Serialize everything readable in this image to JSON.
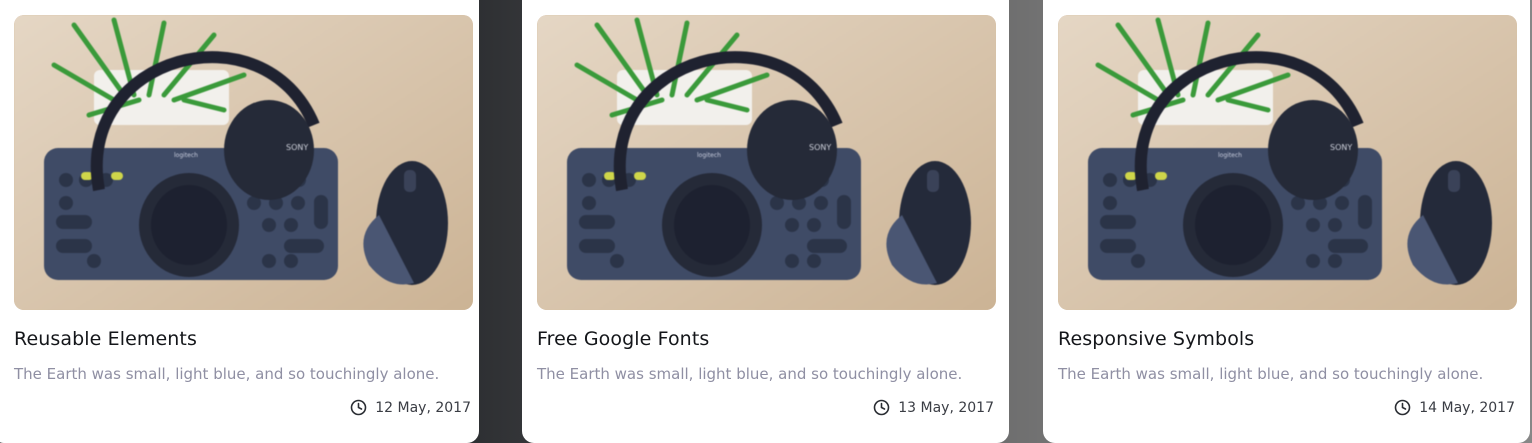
{
  "cards": [
    {
      "title": "Reusable Elements",
      "description": "The Earth was small, light blue, and so touchingly alone.",
      "date": "12 May, 2017",
      "image_icon": "desk-setup-photo",
      "meta_icon": "clock-icon"
    },
    {
      "title": "Free Google Fonts",
      "description": "The Earth was small, light blue, and so touchingly alone.",
      "date": "13 May, 2017",
      "image_icon": "desk-setup-photo",
      "meta_icon": "clock-icon"
    },
    {
      "title": "Responsive Symbols",
      "description": "The Earth was small, light blue, and so touchingly alone.",
      "date": "14 May, 2017",
      "image_icon": "desk-setup-photo",
      "meta_icon": "clock-icon"
    }
  ],
  "photo_text": {
    "headphone_brand": "SONY",
    "keyboard_brand": "logitech"
  },
  "colors": {
    "title": "#14161a",
    "description": "#8f8fa3",
    "date": "#3a3d44",
    "photo_background": "#d6bfa2"
  }
}
